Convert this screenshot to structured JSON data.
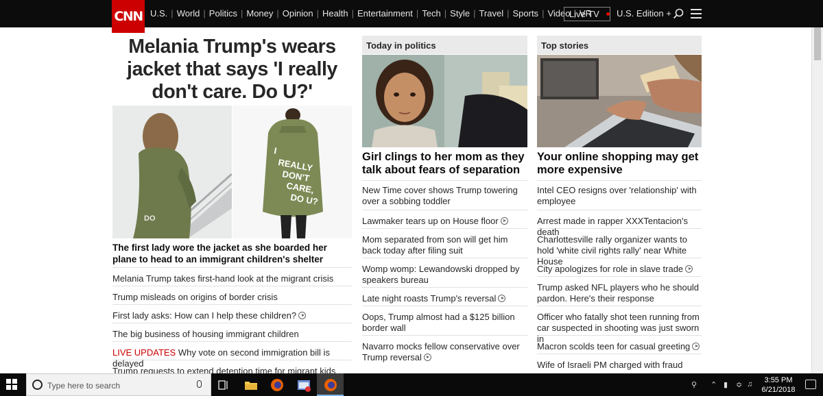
{
  "nav": {
    "logo": "CNN",
    "links": [
      "U.S.",
      "World",
      "Politics",
      "Money",
      "Opinion",
      "Health",
      "Entertainment",
      "Tech",
      "Style",
      "Travel",
      "Sports",
      "Video",
      "VR"
    ],
    "live_tv": "Live TV",
    "edition": "U.S. Edition +"
  },
  "main": {
    "headline": "Melania Trump's wears jacket that says 'I really don't care. Do U?'",
    "jacket_text": [
      "I",
      "REALLY",
      "DON'T",
      "CARE,",
      "DO U?"
    ],
    "lead": "The first lady wore the jacket as she boarded her plane to head to an immigrant children's shelter",
    "items": [
      "Melania Trump takes first-hand look at the migrant crisis",
      "Trump misleads on origins of border crisis",
      "First lady asks: How can I help these children?",
      "The big business of housing immigrant children",
      "Why vote on second immigration bill is delayed",
      "Trump requests to extend detention time for migrant kids"
    ],
    "live_label": "LIVE UPDATES"
  },
  "politics": {
    "header": "Today in politics",
    "subhead": "Girl clings to her mom as they talk about fears of separation",
    "items": [
      "New Time cover shows Trump towering over a sobbing toddler",
      "Lawmaker tears up on House floor",
      "Mom separated from son will get him back today after filing suit",
      "Womp womp: Lewandowski dropped by speakers bureau",
      "Late night roasts Trump's reversal",
      "Oops, Trump almost had a $125 billion border wall",
      "Navarro mocks fellow conservative over Trump reversal"
    ]
  },
  "top": {
    "header": "Top stories",
    "subhead": "Your online shopping may get more expensive",
    "items": [
      "Intel CEO resigns over 'relationship' with employee",
      "Arrest made in rapper XXXTentacion's death",
      "Charlottesville rally organizer wants to hold 'white civil rights rally' near White House",
      "City apologizes for role in slave trade",
      "Trump asked NFL players who he should pardon. Here's their response",
      "Officer who fatally shot teen running from car suspected in shooting was just sworn in",
      "Macron scolds teen for casual greeting",
      "Wife of Israeli PM charged with fraud"
    ]
  },
  "taskbar": {
    "search_placeholder": "Type here to search",
    "time": "3:55 PM",
    "date": "6/21/2018"
  },
  "colors": {
    "cnn_red": "#cc0000",
    "nav_bg": "#0c0c0c",
    "live_red": "#cc0000"
  }
}
